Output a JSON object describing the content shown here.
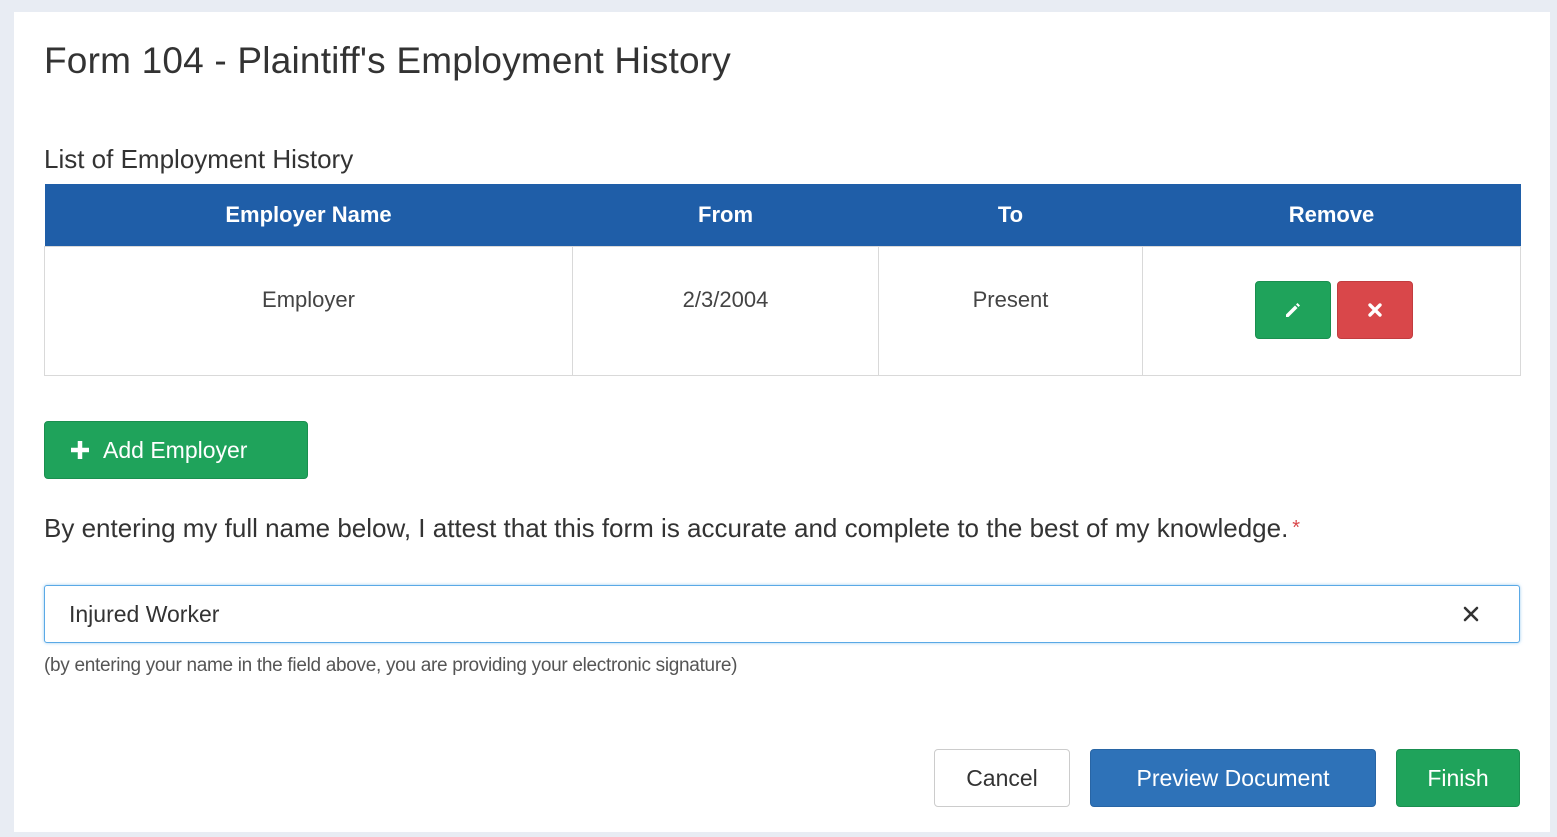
{
  "form": {
    "title": "Form 104 - Plaintiff's Employment History",
    "list_label": "List of Employment History"
  },
  "table": {
    "columns": [
      "Employer Name",
      "From",
      "To",
      "Remove"
    ],
    "rows": [
      {
        "employer": "Employer",
        "from": "2/3/2004",
        "to": "Present",
        "edit_icon": "pencil-icon",
        "remove_icon": "times-icon"
      }
    ]
  },
  "add_button": {
    "label": "Add Employer",
    "icon": "plus-icon"
  },
  "attestation": {
    "text": "By entering my full name below, I attest that this form is accurate and complete to the best of my knowledge.",
    "required_marker": "*",
    "signature_value": "Injured Worker",
    "clear_icon": "close-icon",
    "hint": "(by entering your name in the field above, you are providing your electronic signature)"
  },
  "footer": {
    "cancel_label": "Cancel",
    "preview_label": "Preview Document",
    "finish_label": "Finish"
  },
  "colors": {
    "header_blue": "#1f5ea8",
    "success_green": "#1fa35b",
    "danger_red": "#d9474a",
    "primary_blue": "#2e72b8",
    "required_red": "#d9474a"
  }
}
